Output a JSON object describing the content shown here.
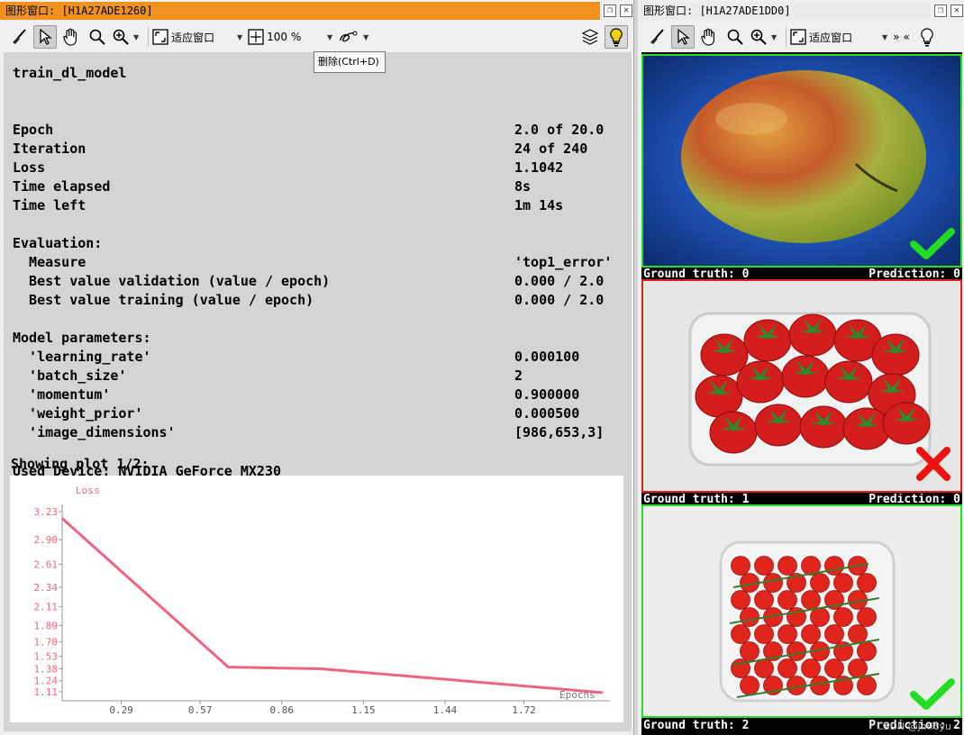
{
  "left_window": {
    "title": "图形窗口: [H1A27ADE1260]",
    "toolbar": {
      "fit_label": "适应窗口",
      "zoom_label": "100 %",
      "tooltip": "删除(Ctrl+D)"
    },
    "content": {
      "heading": "train_dl_model",
      "rows": [
        {
          "label": "Epoch",
          "value": "2.0 of 20.0"
        },
        {
          "label": "Iteration",
          "value": "24 of 240"
        },
        {
          "label": "Loss",
          "value": "1.1042"
        },
        {
          "label": "Time elapsed",
          "value": "8s"
        },
        {
          "label": "Time left",
          "value": "1m 14s"
        }
      ],
      "evaluation": {
        "header": "Evaluation:",
        "rows": [
          {
            "label": "  Measure",
            "value": "'top1_error'"
          },
          {
            "label": "  Best value validation (value / epoch)",
            "value": "0.000 / 2.0"
          },
          {
            "label": "  Best value training (value / epoch)",
            "value": "0.000 / 2.0"
          }
        ]
      },
      "model_params": {
        "header": "Model parameters:",
        "rows": [
          {
            "label": "  'learning_rate'",
            "value": "0.000100"
          },
          {
            "label": "  'batch_size'",
            "value": "2"
          },
          {
            "label": "  'momentum'",
            "value": "0.900000"
          },
          {
            "label": "  'weight_prior'",
            "value": "0.000500"
          },
          {
            "label": "  'image_dimensions'",
            "value": "[986,653,3]"
          }
        ]
      },
      "showing_plot": "Showing plot 1/2:",
      "device": "Used Device: NVIDIA GeForce MX230"
    },
    "chart_data": {
      "type": "line",
      "ylabel": "Loss",
      "xlabel": "Epochs",
      "y_ticks": [
        3.23,
        2.9,
        2.61,
        2.34,
        2.11,
        1.89,
        1.7,
        1.53,
        1.38,
        1.24,
        1.11
      ],
      "y_tick_labels": [
        "3.23",
        "2.90",
        "2.61",
        "2.34",
        "2.11",
        "1.89",
        "1.70",
        "1.53",
        "1.38",
        "1.24",
        "1.11"
      ],
      "x_ticks": [
        0.29,
        0.57,
        0.86,
        1.15,
        1.44,
        1.72
      ],
      "x_tick_labels": [
        "0.29",
        "0.57",
        "0.86",
        "1.15",
        "1.44",
        "1.72"
      ],
      "xlim": [
        0.08,
        2.0
      ],
      "series": [
        {
          "x": [
            0.08,
            0.67,
            1.0,
            2.0
          ],
          "y": [
            3.15,
            1.4,
            1.38,
            1.1
          ]
        }
      ],
      "color": "#f0647e",
      "grid": false
    }
  },
  "right_window": {
    "title": "图形窗口: [H1A27ADE1DD0]",
    "toolbar": {
      "fit_label": "适应窗口"
    },
    "tiles": [
      {
        "ground_truth": "Ground truth: 0",
        "prediction": "Prediction: 0",
        "correct": true,
        "border": "#22e022",
        "subject": "apple"
      },
      {
        "ground_truth": "Ground truth: 1",
        "prediction": "Prediction: 0",
        "correct": false,
        "border": "#e02020",
        "subject": "strawberries"
      },
      {
        "ground_truth": "Ground truth: 2",
        "prediction": "Prediction: 2",
        "correct": true,
        "border": "#22e022",
        "subject": "tomatoes"
      }
    ],
    "watermark": "CSDN @jml6yu"
  }
}
